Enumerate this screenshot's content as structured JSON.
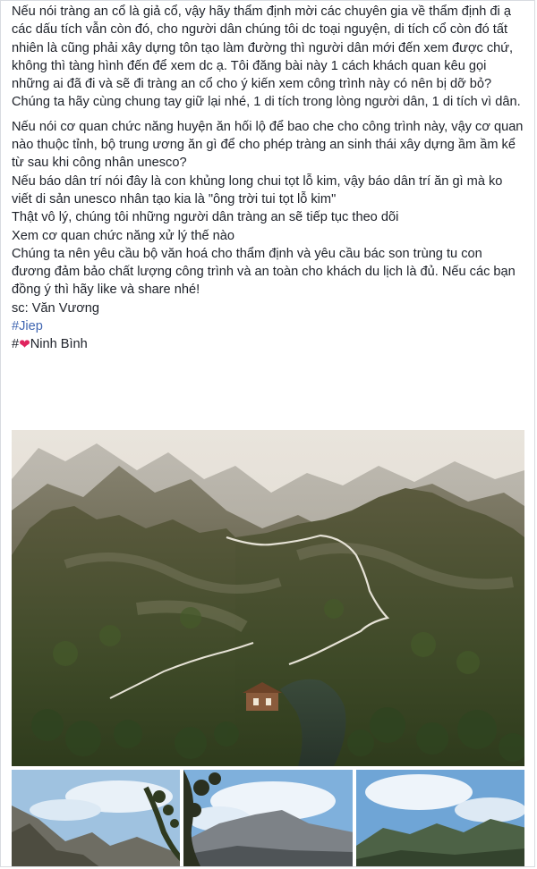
{
  "post": {
    "paragraph1": "Nếu nói tràng an cổ là giả cổ, vậy hãy thẩm định mời các chuyên gia về thẩm định đi ạ các dấu tích vẫn còn đó, cho người dân chúng tôi dc toại nguyện, di tích cổ còn đó tất nhiên là cũng phải xây dựng tôn tạo làm đường thì người dân mới đến xem được chứ, không thì tàng hình đến để xem dc ạ. Tôi đăng bài này 1 cách khách quan kêu gọi những ai đã đi và sẽ đi tràng an cổ cho ý kiến xem công trình này có nên bị dỡ bỏ? Chúng ta hãy cùng chung tay giữ lại nhé, 1 di tích trong lòng người dân, 1 di tích vì dân.",
    "paragraph2_lines": [
      "Nếu nói cơ quan chức năng huyện ăn hối lộ để bao che cho công trình này, vậy cơ quan nào thuộc tỉnh, bộ trung ương ăn gì để cho phép tràng an sinh thái xây dựng ầm ầm kể từ sau khi công nhân unesco?",
      "Nếu báo dân trí nói đây là con khủng long chui tọt lỗ kim, vậy báo dân trí ăn gì mà ko viết di sản unesco nhân tạo kia là \"ông trời tui tọt lỗ kim\"",
      "Thật vô lý, chúng tôi những người dân tràng an sẽ tiếp tục theo dõi",
      "Xem cơ quan chức năng xử lý thế nào",
      "Chúng ta nên yêu cầu bộ văn hoá cho thẩm định và yêu cầu bác son trùng tu con đương đảm bảo chất lượng công trình và an toàn cho khách du lịch là đủ. Nếu các bạn đồng ý thì hãy like và share nhé!"
    ],
    "source": "sc: Văn Vương",
    "hashtag1": "#Jiep",
    "hashtag2_prefix": "#",
    "hashtag2_text": "Ninh Bình"
  },
  "icons": {
    "heart": "heart-icon"
  },
  "colors": {
    "link": "#4267b2",
    "heart": "#e0245e",
    "text": "#1d2129"
  }
}
